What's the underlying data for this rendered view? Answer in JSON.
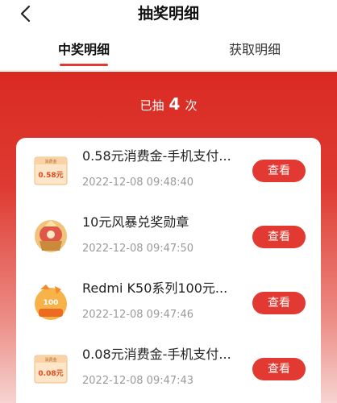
{
  "header": {
    "title": "抽奖明细"
  },
  "tabs": [
    {
      "label": "中奖明细",
      "active": true
    },
    {
      "label": "获取明细",
      "active": false
    }
  ],
  "summary": {
    "prefix": "已抽",
    "count": "4",
    "suffix": "次"
  },
  "records": [
    {
      "title": "0.58元消费金-手机支付...",
      "time": "2022-12-08 09:48:40",
      "action": "查看",
      "thumb_text": "0.58元",
      "thumb_caption": "消费金",
      "thumb_type": "coupon"
    },
    {
      "title": "10元风暴兑奖勋章",
      "time": "2022-12-08 09:47:50",
      "action": "查看",
      "thumb_type": "medal"
    },
    {
      "title": "Redmi K50系列100元...",
      "time": "2022-12-08 09:47:46",
      "action": "查看",
      "thumb_text": "100",
      "thumb_type": "voucher"
    },
    {
      "title": "0.08元消费金-手机支付...",
      "time": "2022-12-08 09:47:43",
      "action": "查看",
      "thumb_text": "0.08元",
      "thumb_caption": "消费金",
      "thumb_type": "coupon"
    }
  ],
  "colors": {
    "accent": "#e23a32",
    "background_red": "#d92a22"
  }
}
